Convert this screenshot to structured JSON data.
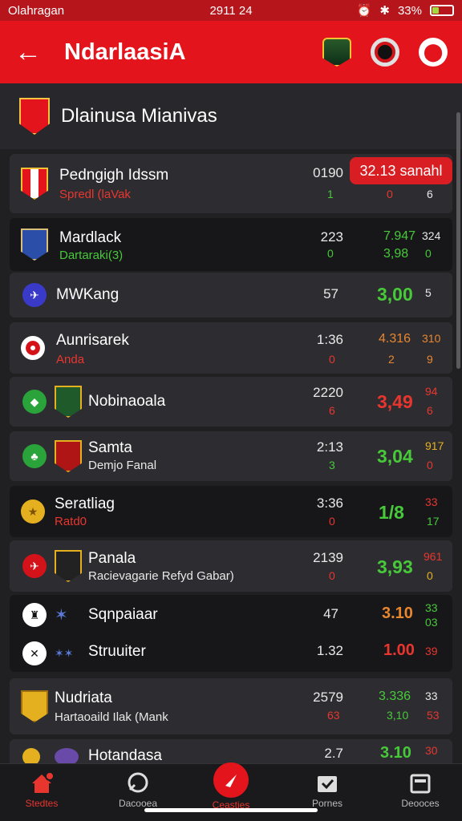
{
  "status": {
    "carrier": "Olahragan",
    "time": "2911 24",
    "battery": "33%",
    "battery_level": 0.33
  },
  "appbar": {
    "title": "NdarlaasiA"
  },
  "league": {
    "name": "Dlainusa Mianivas"
  },
  "rows": [
    {
      "team": "Pedngigh Idssm",
      "sub": "Spredl (laVak",
      "num": "0190",
      "num2": "1",
      "odds_badge": "32.13 sanahl",
      "b": "0",
      "c": "6"
    },
    {
      "team": "Mardlack",
      "sub": "Dartaraki(3)",
      "num": "223",
      "num2": "0",
      "odds": "7.947",
      "odds2": "3,98",
      "c": "324",
      "c2": "0"
    },
    {
      "team": "MWKang",
      "num": "57",
      "odds": "3,00",
      "c": "5"
    },
    {
      "team": "Aunrisarek",
      "sub": "Anda",
      "num": "1:36",
      "num2": "0",
      "odds": "4.316",
      "odds2": "2",
      "c": "310",
      "c2": "9"
    },
    {
      "team": "Nobinaoala",
      "num": "2220",
      "num2": "6",
      "odds": "3,49",
      "c": "94",
      "c2": "6"
    },
    {
      "team": "Samta",
      "sub": "Demjo Fanal",
      "num": "2:13",
      "num2": "3",
      "odds": "3,04",
      "c": "917",
      "c2": "0"
    },
    {
      "team": "Seratliag",
      "sub": "Ratd0",
      "num": "3:36",
      "num2": "0",
      "odds": "1/8",
      "c": "33",
      "c2": "17"
    },
    {
      "team": "Panala",
      "sub": "Racievagarie Refyd Gabar)",
      "num": "2139",
      "num2": "0",
      "odds": "3,93",
      "c": "961",
      "c2": "0"
    },
    {
      "team": "Sqnpaiaar",
      "num": "47",
      "odds": "3.10",
      "c": "33",
      "c2": "03"
    },
    {
      "team": "Struuiter",
      "num": "1.32",
      "odds": "1.00",
      "c": "39"
    },
    {
      "team": "Nudriata",
      "sub": "Hartaoaild Ilak (Mank",
      "num": "2579",
      "num2": "63",
      "odds": "3.336",
      "odds2": "3,10",
      "c": "33",
      "c2": "53"
    },
    {
      "team": "Hotandasa",
      "num": "2.7",
      "odds": "3.10",
      "c": "30"
    }
  ],
  "tabs": [
    {
      "label": "Stedtes"
    },
    {
      "label": "Dacooea"
    },
    {
      "label": "Ceasties"
    },
    {
      "label": "Pornes"
    },
    {
      "label": "Deooces"
    }
  ],
  "colors": {
    "brand_red": "#e4141d",
    "green": "#47c93a",
    "orange": "#e8862f",
    "red": "#e8362f"
  },
  "icons": [
    "back-arrow-icon",
    "team-crest-icon",
    "record-icon",
    "location-pin-icon",
    "home-icon",
    "search-icon",
    "play-icon",
    "calendar-icon",
    "news-icon"
  ]
}
